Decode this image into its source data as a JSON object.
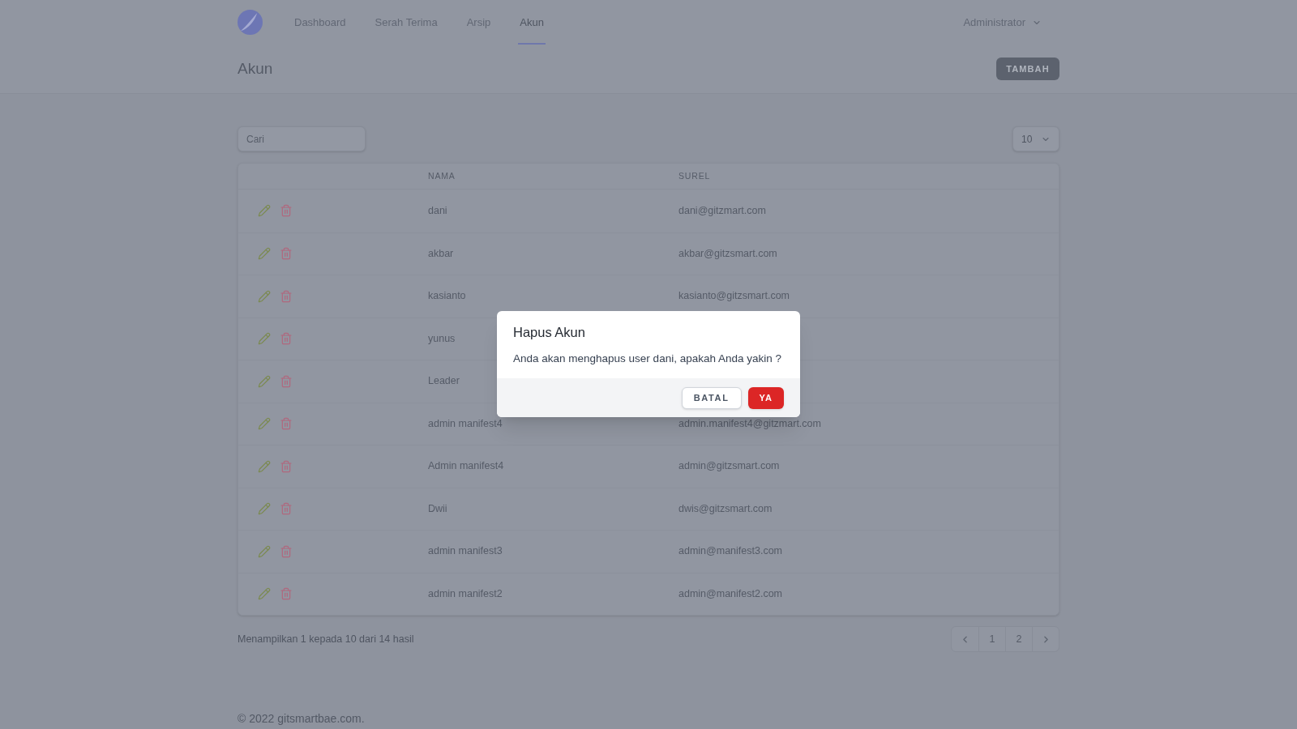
{
  "nav": {
    "links": [
      {
        "label": "Dashboard",
        "selected": false
      },
      {
        "label": "Serah Terima",
        "selected": false
      },
      {
        "label": "Arsip",
        "selected": false
      },
      {
        "label": "Akun",
        "selected": true
      }
    ],
    "user_menu": "Administrator"
  },
  "page_header": {
    "title": "Akun",
    "add_button": "TAMBAH"
  },
  "search": {
    "placeholder": "Cari"
  },
  "page_size": {
    "value": "10"
  },
  "table": {
    "columns": [
      "NAMA",
      "SUREL"
    ],
    "rows": [
      {
        "name": "dani",
        "email": "dani@gitzmart.com"
      },
      {
        "name": "akbar",
        "email": "akbar@gitzsmart.com"
      },
      {
        "name": "kasianto",
        "email": "kasianto@gitzsmart.com"
      },
      {
        "name": "yunus"
      },
      {
        "name": "Leader"
      },
      {
        "name": "admin manifest4",
        "email": "admin.manifest4@gitzmart.com"
      },
      {
        "name": "Admin manifest4",
        "email": "admin@gitzsmart.com"
      },
      {
        "name": "Dwii",
        "email": "dwis@gitzsmart.com"
      },
      {
        "name": "admin manifest3",
        "email": "admin@manifest3.com"
      },
      {
        "name": "admin manifest2",
        "email": "admin@manifest2.com"
      }
    ]
  },
  "pagination": {
    "summary": "Menampilkan 1 kepada 10 dari 14 hasil",
    "pages": [
      "1",
      "2"
    ]
  },
  "footer": {
    "copyright": "© 2022 gitsmartbae.com."
  },
  "dialog": {
    "title": "Hapus Akun",
    "message": "Anda akan menghapus user dani, apakah Anda yakin ?",
    "buttons": [
      {
        "label": "BATAL",
        "kind": "secondary"
      },
      {
        "label": "YA",
        "kind": "danger"
      }
    ]
  }
}
